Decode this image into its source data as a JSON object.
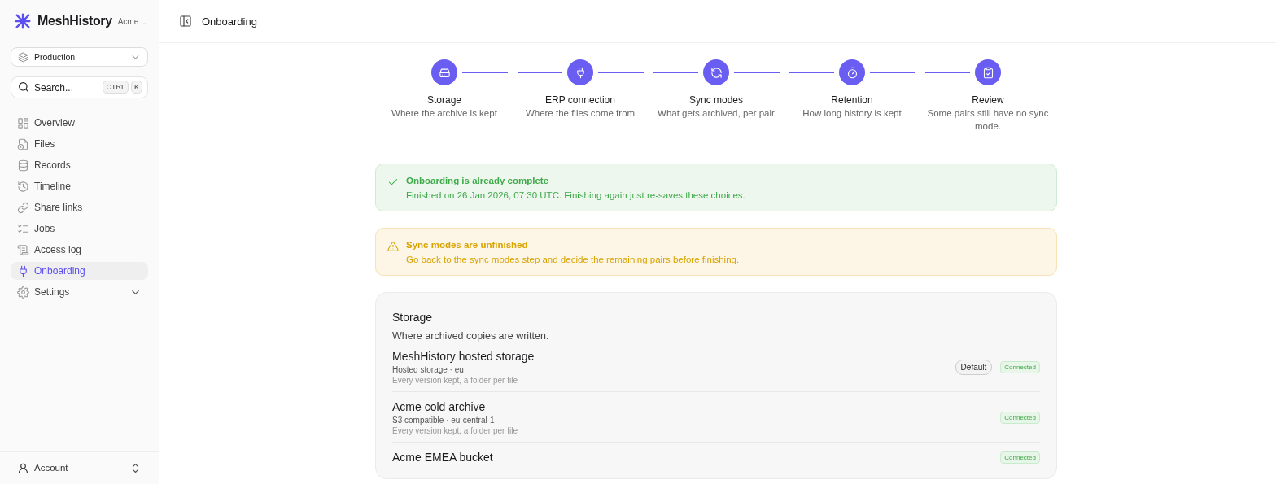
{
  "brand": {
    "name": "MeshHistory",
    "org": "Acme ..."
  },
  "environment": {
    "value": "Production"
  },
  "search": {
    "placeholder": "Search...",
    "keys": [
      "CTRL",
      "K"
    ]
  },
  "sidebar": {
    "items": [
      {
        "label": "Overview",
        "selected": false
      },
      {
        "label": "Files",
        "selected": false
      },
      {
        "label": "Records",
        "selected": false
      },
      {
        "label": "Timeline",
        "selected": false
      },
      {
        "label": "Share links",
        "selected": false
      },
      {
        "label": "Jobs",
        "selected": false
      },
      {
        "label": "Access log",
        "selected": false
      },
      {
        "label": "Onboarding",
        "selected": true
      },
      {
        "label": "Settings",
        "selected": false,
        "expanded": false
      }
    ]
  },
  "account": {
    "label": "Account"
  },
  "header": {
    "title": "Onboarding"
  },
  "steps": [
    {
      "title": "Storage",
      "subtitle": "Where the archive is kept"
    },
    {
      "title": "ERP connection",
      "subtitle": "Where the files come from"
    },
    {
      "title": "Sync modes",
      "subtitle": "What gets archived, per pair"
    },
    {
      "title": "Retention",
      "subtitle": "How long history is kept"
    },
    {
      "title": "Review",
      "subtitle": "Some pairs still have no sync mode."
    }
  ],
  "alerts": [
    {
      "kind": "success",
      "title": "Onboarding is already complete",
      "message": "Finished on 26 Jan 2026, 07:30 UTC. Finishing again just re-saves these choices."
    },
    {
      "kind": "warning",
      "title": "Sync modes are unfinished",
      "message": "Go back to the sync modes step and decide the remaining pairs before finishing."
    }
  ],
  "storage": {
    "title": "Storage",
    "description": "Where archived copies are written.",
    "items": [
      {
        "name": "MeshHistory hosted storage",
        "subtitle": "Hosted storage · eu",
        "detail": "Every version kept, a folder per file",
        "badges": [
          {
            "kind": "default",
            "label": "Default"
          },
          {
            "kind": "status",
            "label": "Connected"
          }
        ]
      },
      {
        "name": "Acme cold archive",
        "subtitle": "S3 compatible · eu-central-1",
        "detail": "Every version kept, a folder per file",
        "badges": [
          {
            "kind": "status",
            "label": "Connected"
          }
        ]
      },
      {
        "name": "Acme EMEA bucket",
        "badges": [
          {
            "kind": "status",
            "label": "Connected"
          }
        ]
      }
    ]
  }
}
